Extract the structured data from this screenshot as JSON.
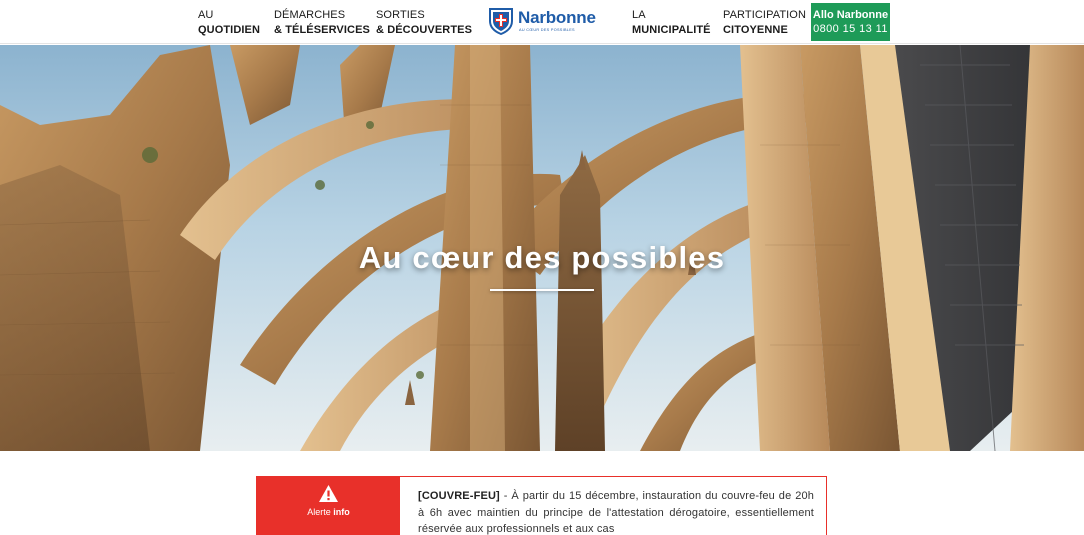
{
  "nav": {
    "quotidien": {
      "line1": "AU",
      "line2": "QUOTIDIEN"
    },
    "demarches": {
      "line1": "DÉMARCHES",
      "line2": "& TÉLÉSERVICES"
    },
    "sorties": {
      "line1": "SORTIES",
      "line2": "& DÉCOUVERTES"
    },
    "municipalite": {
      "line1": "LA",
      "line2": "MUNICIPALITÉ"
    },
    "participation": {
      "line1": "PARTICIPATION",
      "line2": "CITOYENNE"
    }
  },
  "logo": {
    "name": "Narbonne",
    "tagline": "AU CŒUR DES POSSIBLES",
    "icon": "city-shield-icon"
  },
  "allo": {
    "title": "Allo Narbonne",
    "phone": "0800 15 13 11",
    "color": "#1e9b58"
  },
  "hero": {
    "title": "Au cœur des possibles"
  },
  "alert": {
    "icon": "warning-triangle-icon",
    "label_prefix": "Alerte",
    "label_strong": "info",
    "tag": "[COUVRE-FEU]",
    "message": " - À partir du 15 décembre, instauration du couvre-feu de 20h à 6h avec maintien du principe de l'attestation dérogatoire, essentiellement réservée aux professionnels et aux cas",
    "color": "#e8302a"
  }
}
